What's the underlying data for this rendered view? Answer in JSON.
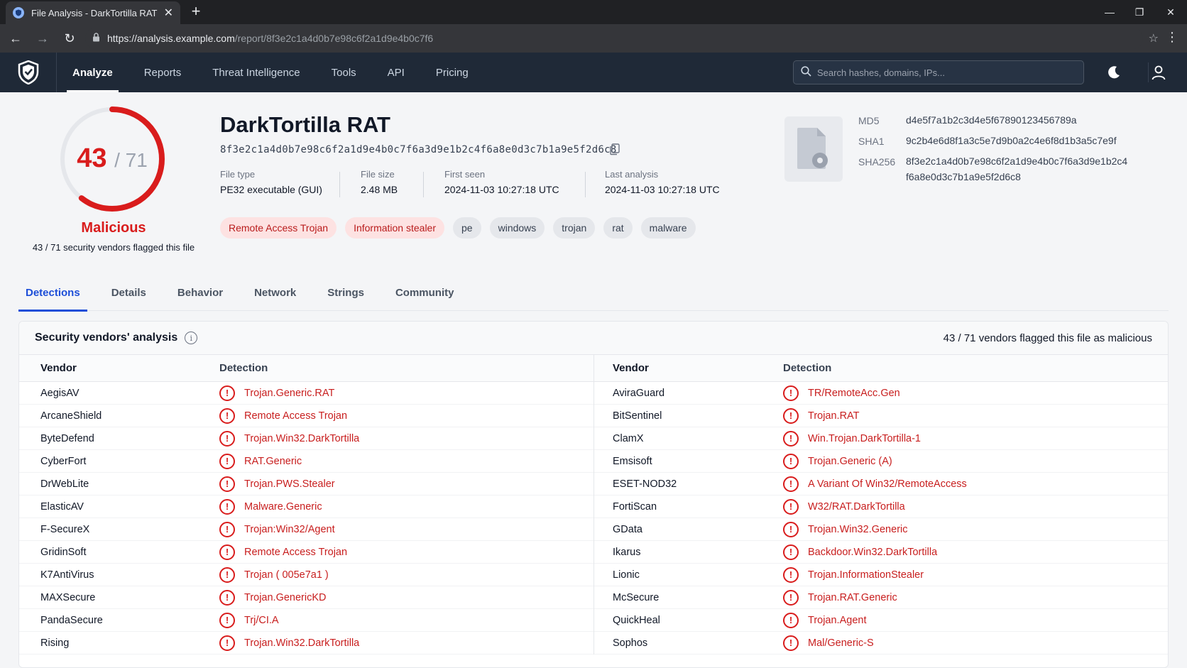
{
  "browser": {
    "tab_title": "File Analysis - DarkTortilla RAT",
    "url_host": "https://analysis.example.com",
    "url_path": "/report/8f3e2c1a4d0b7e98c6f2a1d9e4b0c7f6"
  },
  "nav": {
    "items": [
      "Analyze",
      "Reports",
      "Threat Intelligence",
      "Tools",
      "API",
      "Pricing"
    ],
    "active": "Analyze",
    "search_placeholder": "Search hashes, domains, IPs..."
  },
  "summary": {
    "detected": "43",
    "total": "/ 71",
    "detection_ratio": 0.6056,
    "verdict": "Malicious",
    "verdict_sub": "43 / 71 security vendors flagged this file",
    "name": "DarkTortilla RAT",
    "hash": "8f3e2c1a4d0b7e98c6f2a1d9e4b0c7f6a3d9e1b2c4f6a8e0d3c7b1a9e5f2d6c8",
    "meta": [
      {
        "label": "File type",
        "value": "PE32 executable (GUI)"
      },
      {
        "label": "File size",
        "value": "2.48 MB"
      },
      {
        "label": "First seen",
        "value": "2024-11-03 10:27:18 UTC"
      },
      {
        "label": "Last analysis",
        "value": "2024-11-03 10:27:18 UTC"
      }
    ],
    "tags_red": [
      "Remote Access Trojan",
      "Information stealer"
    ],
    "tags": [
      "pe",
      "windows",
      "trojan",
      "rat",
      "malware"
    ],
    "hashes": {
      "md5_label": "MD5",
      "md5": "d4e5f7a1b2c3d4e5f67890123456789a",
      "sha1_label": "SHA1",
      "sha1": "9c2b4e6d8f1a3c5e7d9b0a2c4e6f8d1b3a5c7e9f",
      "sha256_label": "SHA256",
      "sha256": "8f3e2c1a4d0b7e98c6f2a1d9e4b0c7f6a3d9e1b2c4 f6a8e0d3c7b1a9e5f2d6c8"
    }
  },
  "tabs": [
    "Detections",
    "Details",
    "Behavior",
    "Network",
    "Strings",
    "Community"
  ],
  "panel": {
    "title": "Security vendors' analysis",
    "count": "43 / 71 vendors flagged this file as malicious",
    "col_vendor": "Vendor",
    "col_detection": "Detection",
    "left": [
      [
        "AegisAV",
        "Trojan.Generic.RAT"
      ],
      [
        "ArcaneShield",
        "Remote Access Trojan"
      ],
      [
        "ByteDefend",
        "Trojan.Win32.DarkTortilla"
      ],
      [
        "CyberFort",
        "RAT.Generic"
      ],
      [
        "DrWebLite",
        "Trojan.PWS.Stealer"
      ],
      [
        "ElasticAV",
        "Malware.Generic"
      ],
      [
        "F-SecureX",
        "Trojan:Win32/Agent"
      ],
      [
        "GridinSoft",
        "Remote Access Trojan"
      ],
      [
        "K7AntiVirus",
        "Trojan ( 005e7a1 )"
      ],
      [
        "MAXSecure",
        "Trojan.GenericKD"
      ],
      [
        "PandaSecure",
        "Trj/CI.A"
      ],
      [
        "Rising",
        "Trojan.Win32.DarkTortilla"
      ]
    ],
    "right": [
      [
        "AviraGuard",
        "TR/RemoteAcc.Gen"
      ],
      [
        "BitSentinel",
        "Trojan.RAT"
      ],
      [
        "ClamX",
        "Win.Trojan.DarkTortilla-1"
      ],
      [
        "Emsisoft",
        "Trojan.Generic (A)"
      ],
      [
        "ESET-NOD32",
        "A Variant Of Win32/RemoteAccess"
      ],
      [
        "FortiScan",
        "W32/RAT.DarkTortilla"
      ],
      [
        "GData",
        "Trojan.Win32.Generic"
      ],
      [
        "Ikarus",
        "Backdoor.Win32.DarkTortilla"
      ],
      [
        "Lionic",
        "Trojan.InformationStealer"
      ],
      [
        "McSecure",
        "Trojan.RAT.Generic"
      ],
      [
        "QuickHeal",
        "Trojan.Agent"
      ],
      [
        "Sophos",
        "Mal/Generic-S"
      ]
    ]
  },
  "colors": {
    "malicious": "#d91c1c",
    "accent": "#1d4ed8",
    "nav_bg": "#1f2937"
  }
}
